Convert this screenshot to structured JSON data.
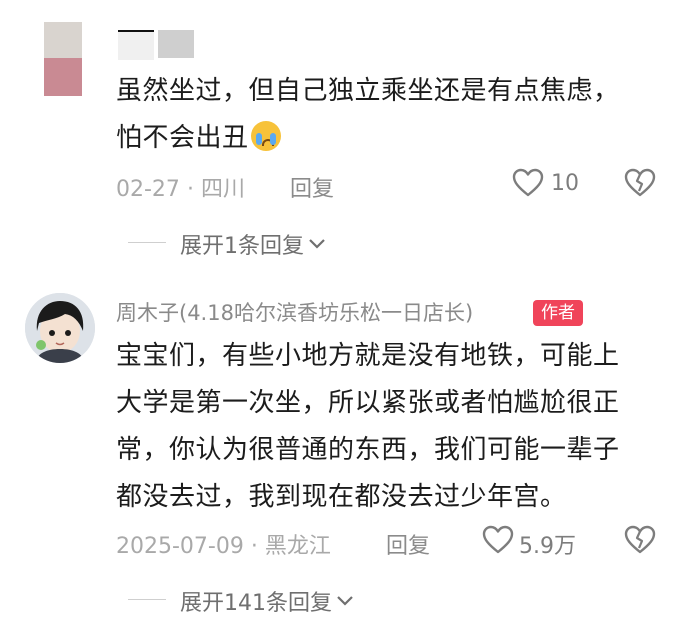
{
  "comment1": {
    "lines": [
      "虽然坐过，但自己独立乘坐还是有点焦虑，",
      "怕不会出丑"
    ],
    "emoji": "loudly-crying-face-icon",
    "date": "02-27",
    "separator": "·",
    "location": "四川",
    "reply_label": "回复",
    "like_count": "10",
    "expand_label": "展开1条回复"
  },
  "comment2": {
    "username": "周木子(4.18哈尔滨香坊乐松一日店长)",
    "author_badge": "作者",
    "lines": [
      "宝宝们，有些小地方就是没有地铁，可能上",
      "大学是第一次坐，所以紧张或者怕尴尬很正",
      "常，你认为很普通的东西，我们可能一辈子",
      "都没去过，我到现在都没去过少年宫。"
    ],
    "date": "2025-07-09",
    "separator": "·",
    "location": "黑龙江",
    "reply_label": "回复",
    "like_count": "5.9万",
    "expand_label": "展开141条回复"
  },
  "colors": {
    "badge": "#f0445a",
    "muted_text": "#a9a9a9",
    "body_text": "#1c1c1c"
  }
}
